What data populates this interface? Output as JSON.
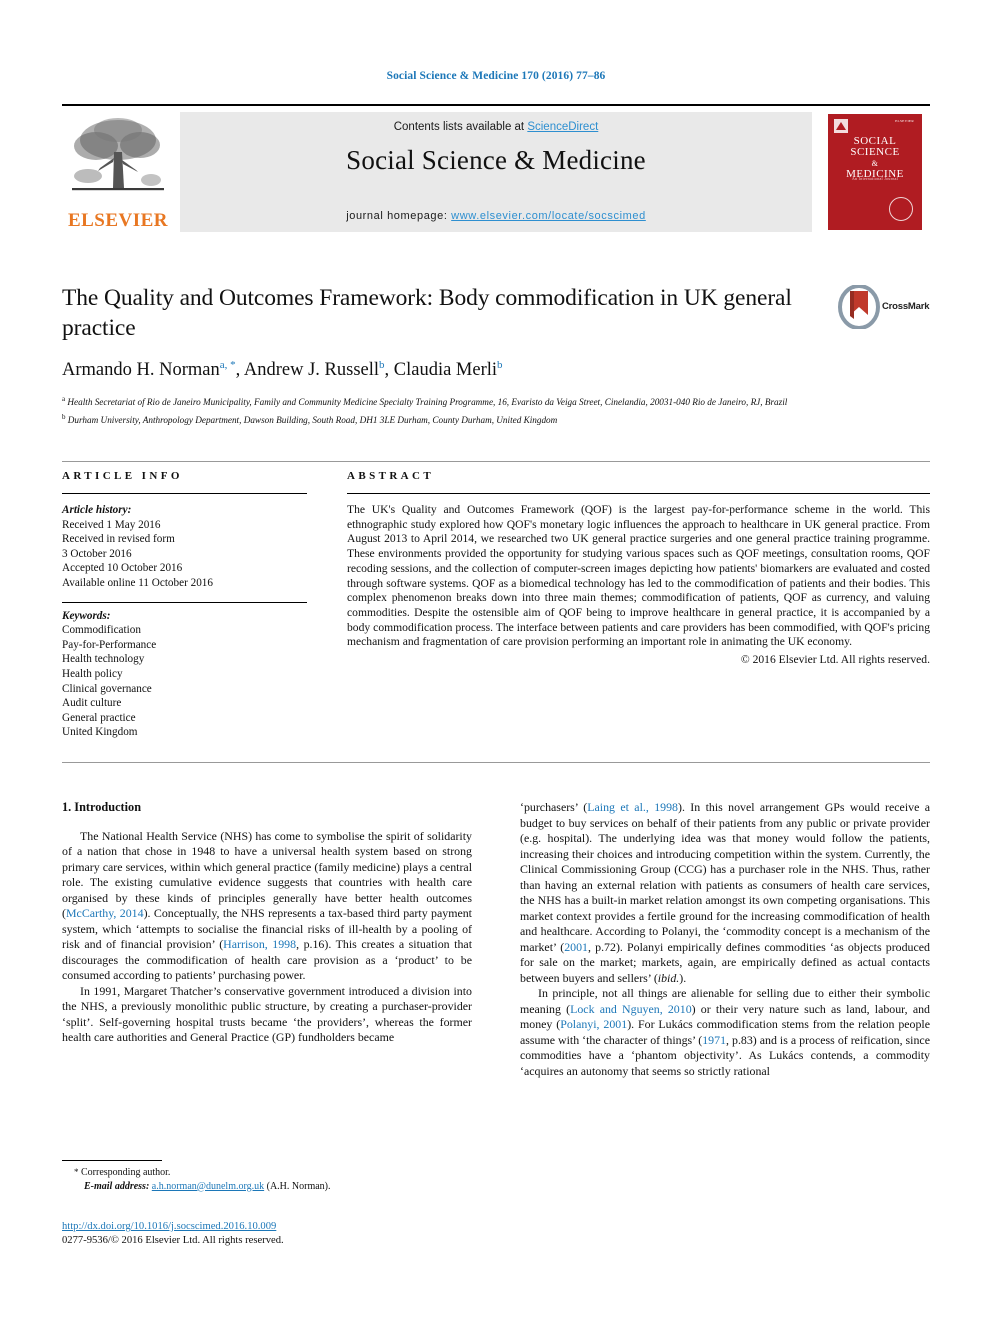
{
  "running_head": "Social Science & Medicine 170 (2016) 77–86",
  "masthead": {
    "publisher_logo_name": "elsevier-tree-logo",
    "publisher_wordmark": "ELSEVIER",
    "contents_prefix": "Contents lists available at ",
    "contents_link": "ScienceDirect",
    "journal_name": "Social Science & Medicine",
    "homepage_prefix": "journal homepage: ",
    "homepage_url": "www.elsevier.com/locate/socscimed",
    "cover": {
      "line1": "SOCIAL",
      "line2": "SCIENCE",
      "line3": "&",
      "line4": "MEDICINE",
      "tagline": "An International Journal",
      "corner_label": "ELSEVIER"
    },
    "accent_blue": "#2e8fd0",
    "elsevier_orange": "#e87722",
    "cover_red": "#b01c22"
  },
  "article": {
    "title": "The Quality and Outcomes Framework: Body commodification in UK general practice",
    "crossmark_label": "CrossMark",
    "authors_html": [
      {
        "name": "Armando H. Norman",
        "marks": "a, *"
      },
      {
        "name": "Andrew J. Russell",
        "marks": "b"
      },
      {
        "name": "Claudia Merli",
        "marks": "b"
      }
    ],
    "affiliations": [
      {
        "mark": "a",
        "text": "Health Secretariat of Rio de Janeiro Municipality, Family and Community Medicine Specialty Training Programme, 16, Evaristo da Veiga Street, Cinelandia, 20031-040 Rio de Janeiro, RJ, Brazil"
      },
      {
        "mark": "b",
        "text": "Durham University, Anthropology Department, Dawson Building, South Road, DH1 3LE Durham, County Durham, United Kingdom"
      }
    ]
  },
  "article_info": {
    "heading": "ARTICLE INFO",
    "history_label": "Article history:",
    "history": [
      "Received 1 May 2016",
      "Received in revised form",
      "3 October 2016",
      "Accepted 10 October 2016",
      "Available online 11 October 2016"
    ],
    "keywords_label": "Keywords:",
    "keywords": [
      "Commodification",
      "Pay-for-Performance",
      "Health technology",
      "Health policy",
      "Clinical governance",
      "Audit culture",
      "General practice",
      "United Kingdom"
    ]
  },
  "abstract": {
    "heading": "ABSTRACT",
    "text": "The UK's Quality and Outcomes Framework (QOF) is the largest pay-for-performance scheme in the world. This ethnographic study explored how QOF's monetary logic influences the approach to healthcare in UK general practice. From August 2013 to April 2014, we researched two UK general practice surgeries and one general practice training programme. These environments provided the opportunity for studying various spaces such as QOF meetings, consultation rooms, QOF recoding sessions, and the collection of computer-screen images depicting how patients' biomarkers are evaluated and costed through software systems. QOF as a biomedical technology has led to the commodification of patients and their bodies. This complex phenomenon breaks down into three main themes; commodification of patients, QOF as currency, and valuing commodities. Despite the ostensible aim of QOF being to improve healthcare in general practice, it is accompanied by a body commodification process. The interface between patients and care providers has been commodified, with QOF's pricing mechanism and fragmentation of care provision performing an important role in animating the UK economy.",
    "copyright": "© 2016 Elsevier Ltd. All rights reserved."
  },
  "body": {
    "section_number_title": "1. Introduction",
    "left_column": [
      "The National Health Service (NHS) has come to symbolise the spirit of solidarity of a nation that chose in 1948 to have a universal health system based on strong primary care services, within which general practice (family medicine) plays a central role. The existing cumulative evidence suggests that countries with health care organised by these kinds of principles generally have better health outcomes (McCarthy, 2014). Conceptually, the NHS represents a tax-based third party payment system, which 'attempts to socialise the financial risks of ill-health by a pooling of risk and of financial provision' (Harrison, 1998, p.16). This creates a situation that discourages the commodification of health care provision as a 'product' to be consumed according to patients' purchasing power.",
      "In 1991, Margaret Thatcher's conservative government introduced a division into the NHS, a previously monolithic public structure, by creating a purchaser-provider 'split'. Self-governing hospital trusts became 'the providers', whereas the former health care authorities and General Practice (GP) fundholders became"
    ],
    "right_column": [
      "'purchasers' (Laing et al., 1998). In this novel arrangement GPs would receive a budget to buy services on behalf of their patients from any public or private provider (e.g. hospital). The underlying idea was that money would follow the patients, increasing their choices and introducing competition within the system. Currently, the Clinical Commissioning Group (CCG) has a purchaser role in the NHS. Thus, rather than having an external relation with patients as consumers of health care services, the NHS has a built-in market relation amongst its own competing organisations. This market context provides a fertile ground for the increasing commodification of health and healthcare. According to Polanyi, the 'commodity concept is a mechanism of the market' (2001, p.72). Polanyi empirically defines commodities 'as objects produced for sale on the market; markets, again, are empirically defined as actual contacts between buyers and sellers' (ibid.).",
      "In principle, not all things are alienable for selling due to either their symbolic meaning (Lock and Nguyen, 2010) or their very nature such as land, labour, and money (Polanyi, 2001). For Lukács commodification stems from the relation people assume with 'the character of things' (1971, p.83) and is a process of reification, since commodities have a 'phantom objectivity'. As Lukács contends, a commodity 'acquires an autonomy that seems so strictly rational"
    ],
    "references_inline": [
      "McCarthy, 2014",
      "Harrison, 1998",
      "Laing et al., 1998",
      "2001",
      "Lock and Nguyen, 2010",
      "Polanyi, 2001",
      "1971"
    ]
  },
  "footer": {
    "corresponding_marker": "*",
    "corresponding_label": "Corresponding author.",
    "email_label": "E-mail address:",
    "email": "a.h.norman@dunelm.org.uk",
    "email_owner": "(A.H. Norman).",
    "doi": "http://dx.doi.org/10.1016/j.socscimed.2016.10.009",
    "issn_line": "0277-9536/© 2016 Elsevier Ltd. All rights reserved."
  }
}
